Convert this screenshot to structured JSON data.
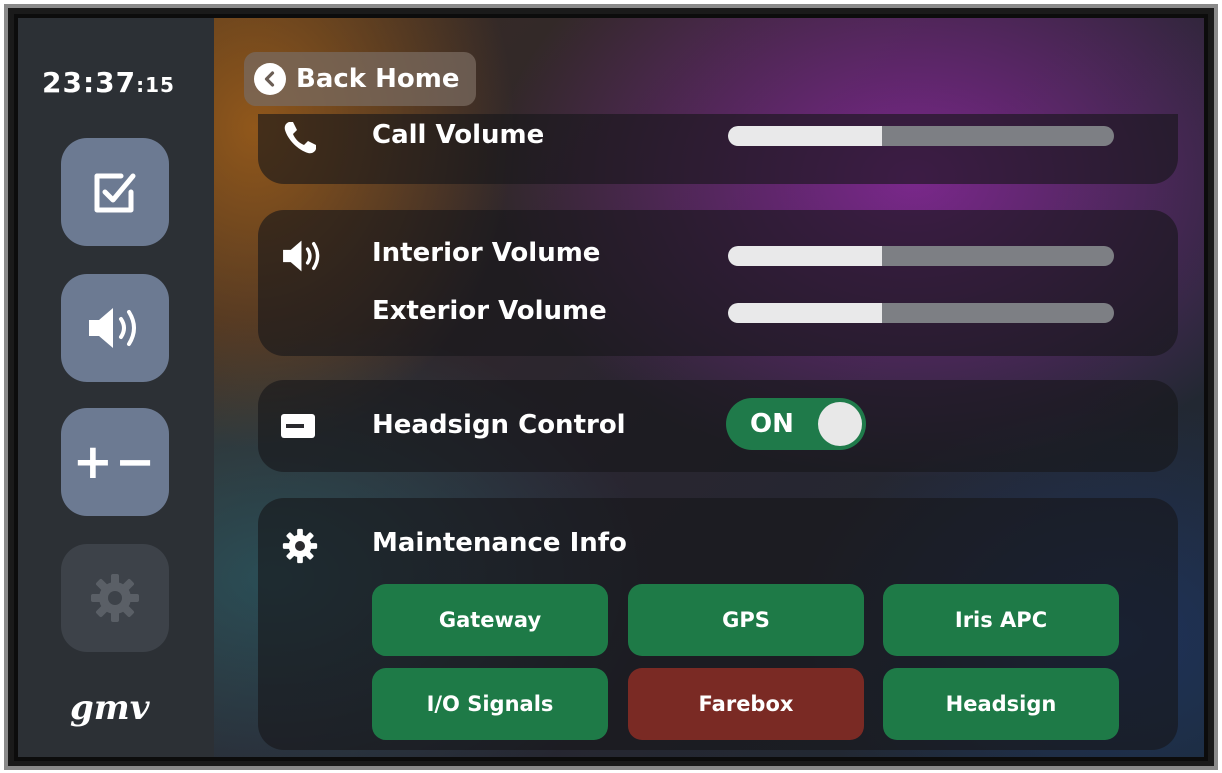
{
  "clock": {
    "time": "23:37",
    "seconds": ":15"
  },
  "rail": {
    "items": [
      {
        "icon": "checklist-icon",
        "active": true
      },
      {
        "icon": "speaker-icon",
        "active": true
      },
      {
        "icon": "plus-minus-icon",
        "label": "+−",
        "active": true
      },
      {
        "icon": "gear-icon",
        "active": false
      }
    ],
    "logo": "gmv"
  },
  "back_button": {
    "label": "Back Home",
    "icon": "chevron-left-icon"
  },
  "call_volume": {
    "label": "Call Volume",
    "icon": "phone-icon",
    "level": 0.4
  },
  "volume_group": {
    "icon": "speaker-icon",
    "interior": {
      "label": "Interior Volume",
      "level": 0.4
    },
    "exterior": {
      "label": "Exterior Volume",
      "level": 0.4
    }
  },
  "headsign_control": {
    "label": "Headsign Control",
    "icon": "display-icon",
    "state": "ON"
  },
  "maintenance": {
    "label": "Maintenance Info",
    "icon": "gear-icon",
    "buttons": [
      {
        "label": "Gateway",
        "status": "ok"
      },
      {
        "label": "GPS",
        "status": "ok"
      },
      {
        "label": "Iris APC",
        "status": "ok"
      },
      {
        "label": "I/O Signals",
        "status": "ok"
      },
      {
        "label": "Farebox",
        "status": "error"
      },
      {
        "label": "Headsign",
        "status": "ok"
      }
    ]
  },
  "colors": {
    "ok": "#1e7a47",
    "error": "#7a2a24",
    "toggle_on": "#1f7a4a",
    "rail_button": "#6c7a92"
  }
}
